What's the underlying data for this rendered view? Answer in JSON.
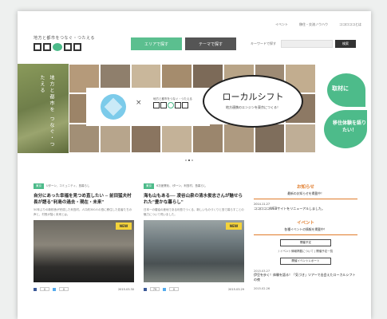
{
  "header": {
    "tagline": "地方と都市をつなぐ・つたえる",
    "top_links": [
      "イベント",
      "移住・交流ノウハウ",
      "ココロココとは"
    ],
    "area_button": "エリアで探す",
    "theme_button": "テーマで探す",
    "keyword_label": "キーワードで探す",
    "search_button": "検索"
  },
  "hero": {
    "vertical_text": "地方と都市を つなぐ・つたえる",
    "bubble_title": "ローカルシフト",
    "bubble_sub": "地方連携のエンジンを東京につくる！",
    "cross": "×",
    "sublogo_tagline": "地方と都市をつなぐ・つたえる",
    "leaf_top": "取材に",
    "leaf_bottom": "移住体験を語りたい！"
  },
  "articles": [
    {
      "tag": "東京",
      "tags_text": "Uターン、コミュニティ、島暮らし",
      "title": "自分にあった幸福を見つめ直したい ─ 前田猛夫村長が語る\"利島の過去・現在・未来\"",
      "desc": "50年ぶりの新校舎が完成した利島村。人口約300人の島に移住した若者たちの声と、村長が描く未来とは。",
      "badge": "NEW",
      "likes": "0",
      "shares": "0",
      "date": "2015.03.30"
    },
    {
      "tag": "東京",
      "tags_text": "6次産業化、Iターン、利島村、島暮らし",
      "title": "海も山もある── 凌谷山泉の清水俊志さんが魅せられた\"豊かな暮らし\"",
      "desc": "日本一の椿油の産地である利島でつくる、新しいものづくりと島で暮らすことの魅力について伺いました。",
      "badge": "NEW",
      "likes": "79",
      "shares": "0",
      "date": "2015.03.29"
    }
  ],
  "sidebar": {
    "news_heading": "お知らせ",
    "news_sub": "最新のお知らせを掲載中！",
    "news_date": "2014.11.27",
    "news_text": "ココロココWEBサイトをリニューアルしました。",
    "event_heading": "イベント",
    "event_sub": "各種イベントの情報を掲載中！",
    "button_upcoming": "開催予定",
    "link_text": "/ イベント情報掲載について | 開催予定一覧",
    "button_report": "開催イベントレポート",
    "item1_date": "2015.03.27",
    "item1_text": "伊豆を歩く！体験を語る！「気づき」ツアーで出会えたローカルシフトの夜",
    "item2_date": "2015.02.26"
  },
  "colors": {
    "green": "#4dbb8a",
    "dark": "#555555",
    "orange": "#e07b2a",
    "badge": "#f4d23a"
  }
}
